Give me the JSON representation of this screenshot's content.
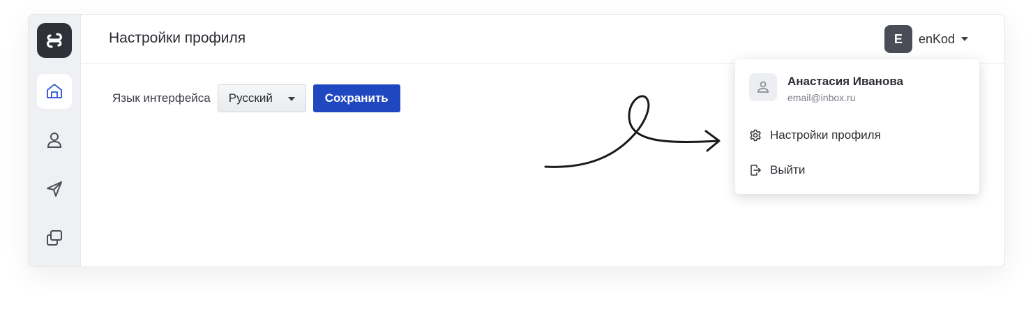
{
  "header": {
    "title": "Настройки профиля"
  },
  "user": {
    "initial": "E",
    "name": "enKod"
  },
  "sidebar": {
    "items": [
      {
        "icon": "home-icon",
        "active": true
      },
      {
        "icon": "user-icon",
        "active": false
      },
      {
        "icon": "send-icon",
        "active": false
      },
      {
        "icon": "copy-icon",
        "active": false
      }
    ]
  },
  "settings": {
    "language_label": "Язык интерфейса",
    "language_value": "Русский",
    "save_label": "Сохранить"
  },
  "dropdown": {
    "full_name": "Анастасия Иванова",
    "email": "email@inbox.ru",
    "items": [
      {
        "label": "Настройки профиля",
        "icon": "gear-icon"
      },
      {
        "label": "Выйти",
        "icon": "logout-icon"
      }
    ]
  },
  "colors": {
    "primary": "#1f48c0",
    "sidebar_bg": "#eef0f3",
    "active_icon": "#3b63d6",
    "dark": "#2e3138"
  }
}
